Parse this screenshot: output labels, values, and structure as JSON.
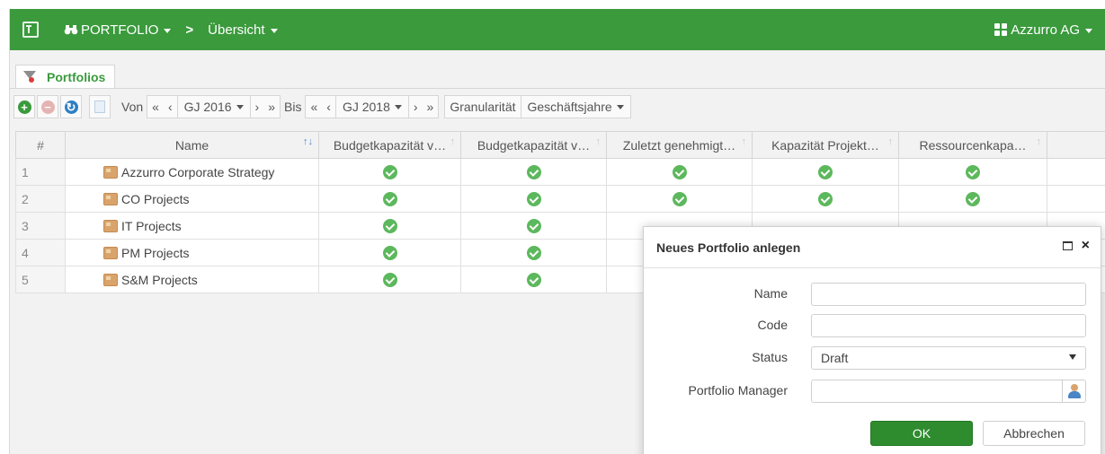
{
  "topbar": {
    "portfolio_label": "PORTFOLIO",
    "separator": ">",
    "overview_label": "Übersicht",
    "company_label": "Azzurro AG"
  },
  "tab": {
    "label": "Portfolios"
  },
  "toolbar": {
    "from_label": "Von",
    "from_year": "GJ 2016",
    "to_label": "Bis",
    "to_year": "GJ 2018",
    "granularity_label": "Granularität",
    "granularity_value": "Geschäftsjahre",
    "first": "«",
    "prev": "‹",
    "next": "›",
    "last": "»"
  },
  "grid": {
    "columns": [
      "#",
      "Name",
      "Budgetkapazität v…",
      "Budgetkapazität v…",
      "Zuletzt genehmigt…",
      "Kapazität Projekt…",
      "Ressourcenkapa…"
    ],
    "rows": [
      {
        "num": "1",
        "name": "Azzurro Corporate Strategy"
      },
      {
        "num": "2",
        "name": "CO Projects"
      },
      {
        "num": "3",
        "name": "IT Projects"
      },
      {
        "num": "4",
        "name": "PM Projects"
      },
      {
        "num": "5",
        "name": "S&M Projects"
      }
    ]
  },
  "dialog": {
    "title": "Neues Portfolio anlegen",
    "name_label": "Name",
    "name_value": "",
    "code_label": "Code",
    "code_value": "",
    "status_label": "Status",
    "status_value": "Draft",
    "manager_label": "Portfolio Manager",
    "manager_value": "",
    "ok_label": "OK",
    "cancel_label": "Abbrechen"
  },
  "colors": {
    "brand_green": "#3a9a3c",
    "check_green": "#5cb85c",
    "ok_button": "#2e8b2e"
  },
  "icons": [
    "app-logo-icon",
    "binoculars-icon",
    "grid-icon",
    "funnel-icon",
    "add-icon",
    "delete-icon",
    "refresh-icon",
    "export-icon",
    "folder-icon",
    "check-icon",
    "maximize-icon",
    "close-icon",
    "person-icon",
    "sort-icon"
  ]
}
